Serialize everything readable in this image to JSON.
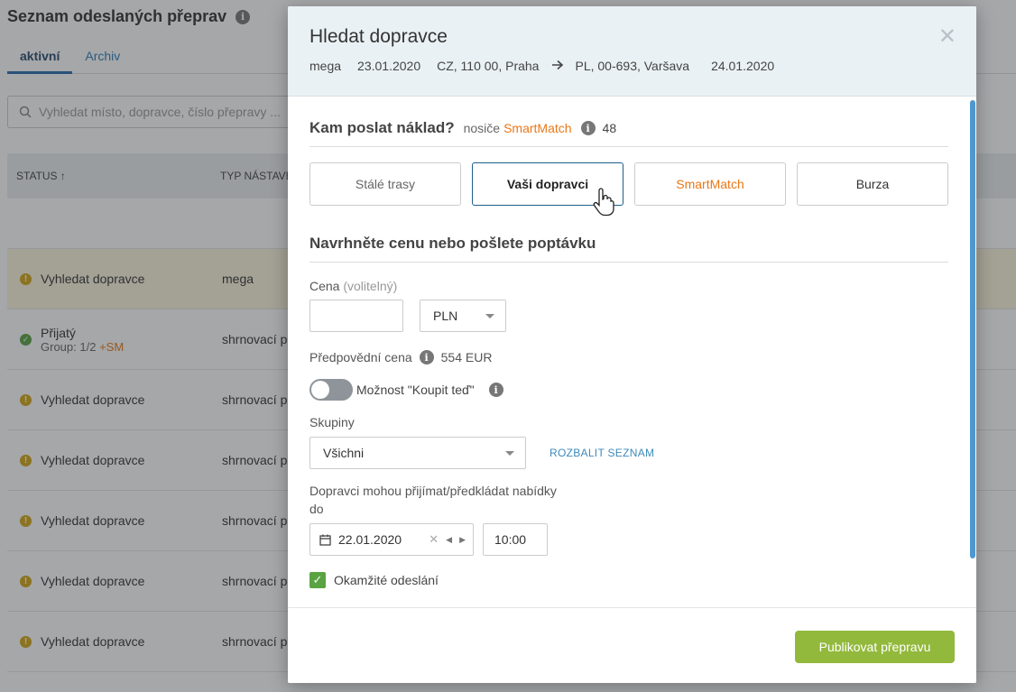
{
  "background": {
    "title": "Seznam odeslaných přeprav",
    "tabs": [
      {
        "label": "aktivní",
        "active": true
      },
      {
        "label": "Archiv",
        "active": false
      }
    ],
    "search_placeholder": "Vyhledat místo, dopravce, číslo přepravy ...",
    "columns": [
      "STATUS ↑",
      "TYP NÁSTAVB"
    ],
    "rows": [
      {
        "status": "Vyhledat dopravce",
        "type": "mega",
        "icon": "warning-icon",
        "highlight": true
      },
      {
        "status": "Přijatý",
        "sub": "Group: 1/2",
        "sub_tag": "+SM",
        "type": "shrnovací p",
        "icon": "check-circle-icon"
      },
      {
        "status": "Vyhledat dopravce",
        "type": "shrnovací p",
        "icon": "warning-icon"
      },
      {
        "status": "Vyhledat dopravce",
        "type": "shrnovací p",
        "icon": "warning-icon"
      },
      {
        "status": "Vyhledat dopravce",
        "type": "shrnovací p",
        "icon": "warning-icon"
      },
      {
        "status": "Vyhledat dopravce",
        "type": "shrnovací p",
        "icon": "warning-icon"
      },
      {
        "status": "Vyhledat dopravce",
        "type": "shrnovací p",
        "icon": "warning-icon"
      }
    ]
  },
  "modal": {
    "title": "Hledat dopravce",
    "meta": {
      "type": "mega",
      "date_from": "23.01.2020",
      "origin": "CZ, 110 00, Praha",
      "destination": "PL, 00-693, Varšava",
      "date_to": "24.01.2020"
    },
    "section_send": {
      "heading": "Kam poslat náklad?",
      "carriers_label": "nosiče",
      "smartmatch_label": "SmartMatch",
      "count": "48"
    },
    "options": [
      {
        "label": "Stálé trasy",
        "selected": false
      },
      {
        "label": "Vaši dopravci",
        "selected": true
      },
      {
        "label": "SmartMatch",
        "selected": false
      },
      {
        "label": "Burza",
        "selected": false
      }
    ],
    "section_price": {
      "heading": "Navrhněte cenu nebo pošlete poptávku",
      "price_label": "Cena",
      "price_optional": "(volitelný)",
      "price_value": "",
      "currency": "PLN",
      "predicted_label": "Předpovědní cena",
      "predicted_value": "554 EUR",
      "buy_now_label": "Možnost \"Koupit teď\"",
      "groups_label": "Skupiny",
      "groups_value": "Všichni",
      "expand_link": "ROZBALIT SEZNAM",
      "deadline_label": "Dopravci mohou přijímat/předkládat nabídky do",
      "deadline_date": "22.01.2020",
      "deadline_time": "10:00",
      "instant_send_label": "Okamžité odeslání"
    },
    "publish_button": "Publikovat přepravu"
  },
  "colors": {
    "accent_orange": "#e87817",
    "publish_green": "#92b93c",
    "link_blue": "#3c8ab8"
  }
}
